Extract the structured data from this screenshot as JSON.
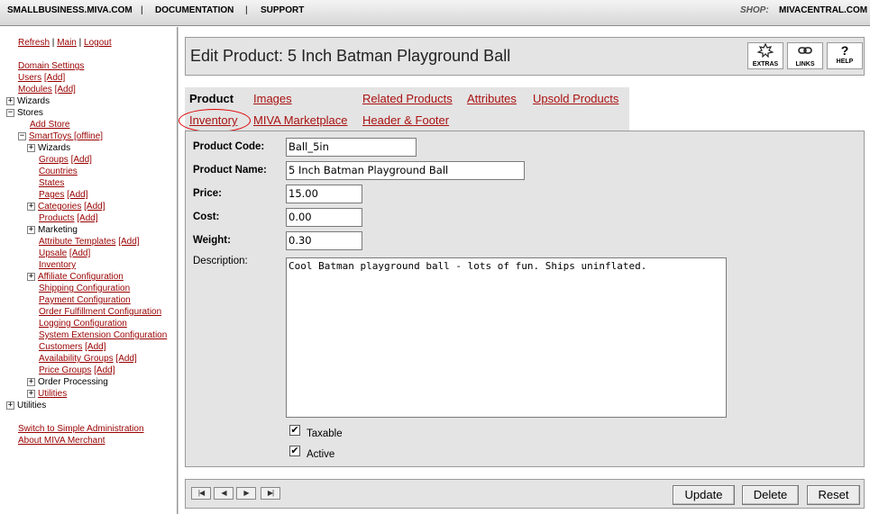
{
  "topbar": {
    "link1": "SMALLBUSINESS.MIVA.COM",
    "link2": "DOCUMENTATION",
    "link3": "SUPPORT",
    "sep": "|",
    "shop_label": "SHOP:",
    "shop_value": "MIVACENTRAL.COM"
  },
  "leftnav": {
    "refresh": "Refresh",
    "main": "Main",
    "logout": "Logout",
    "pipe": "|",
    "domain_settings": "Domain Settings",
    "users": "Users",
    "modules": "Modules",
    "add": "[Add]",
    "wizards": "Wizards",
    "stores": "Stores",
    "add_store": "Add Store",
    "store_name": "SmartToys [offline]",
    "store_wizards": "Wizards",
    "groups": "Groups",
    "countries": "Countries",
    "states": "States",
    "pages": "Pages",
    "categories": "Categories",
    "products": "Products",
    "marketing": "Marketing",
    "attribute_templates": "Attribute Templates",
    "upsale": "Upsale",
    "inventory": "Inventory",
    "affiliate_configuration": "Affiliate Configuration",
    "shipping_configuration": "Shipping Configuration",
    "payment_configuration": "Payment Configuration",
    "order_fulfillment_configuration": "Order Fulfillment Configuration",
    "logging_configuration": "Logging Configuration",
    "system_extension_configuration": "System Extension Configuration",
    "customers": "Customers",
    "availability_groups": "Availability Groups",
    "price_groups": "Price Groups",
    "order_processing": "Order Processing",
    "store_utilities": "Utilities",
    "utilities": "Utilities",
    "switch_simple": "Switch to Simple Administration",
    "about": "About MIVA Merchant",
    "plus": "+",
    "minus": "−"
  },
  "header": {
    "title": "Edit Product: 5 Inch Batman Playground Ball",
    "extras": "EXTRAS",
    "links": "LINKS",
    "help": "HELP",
    "help_icon": "?"
  },
  "tabs": {
    "product": "Product",
    "images": "Images",
    "related_products": "Related Products",
    "attributes": "Attributes",
    "upsold_products": "Upsold Products",
    "inventory": "Inventory",
    "miva_marketplace": "MIVA Marketplace",
    "header_footer": "Header & Footer"
  },
  "form": {
    "product_code_label": "Product Code:",
    "product_code": "Ball_5in",
    "product_name_label": "Product Name:",
    "product_name": "5 Inch Batman Playground Ball",
    "price_label": "Price:",
    "price": "15.00",
    "cost_label": "Cost:",
    "cost": "0.00",
    "weight_label": "Weight:",
    "weight": "0.30",
    "description_label": "Description:",
    "description": "Cool Batman playground ball - lots of fun. Ships uninflated.",
    "taxable_label": "Taxable",
    "taxable_checked": true,
    "active_label": "Active",
    "active_checked": true,
    "check_glyph": "✔"
  },
  "bottombar": {
    "first": "|◀",
    "prev": "◀",
    "next": "▶",
    "last": "▶|",
    "update": "Update",
    "delete": "Delete",
    "reset": "Reset"
  }
}
